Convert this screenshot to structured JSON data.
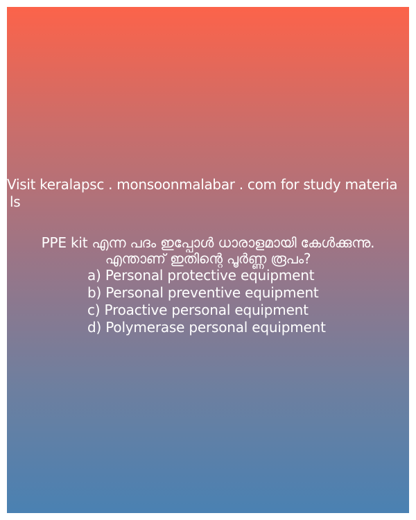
{
  "promo": {
    "line1": "Visit keralapsc . monsoonmalabar . com for study materia",
    "line2": "ls"
  },
  "question": {
    "line1": "PPE kit എന്ന പദം ഇപ്പോൾ ധാരാളമായി കേൾക്കുന്നു.",
    "line2": "എന്താണ് ഇതിന്റെ പൂർണ്ണ രൂപം?"
  },
  "options": [
    "a) Personal protective equipment",
    "b) Personal preventive equipment",
    "c) Proactive personal equipment",
    "d) Polymerase personal equipment"
  ],
  "colors": {
    "gradient_top": "#fc634a",
    "gradient_bottom": "#4a81b2",
    "text": "#ffffff"
  }
}
